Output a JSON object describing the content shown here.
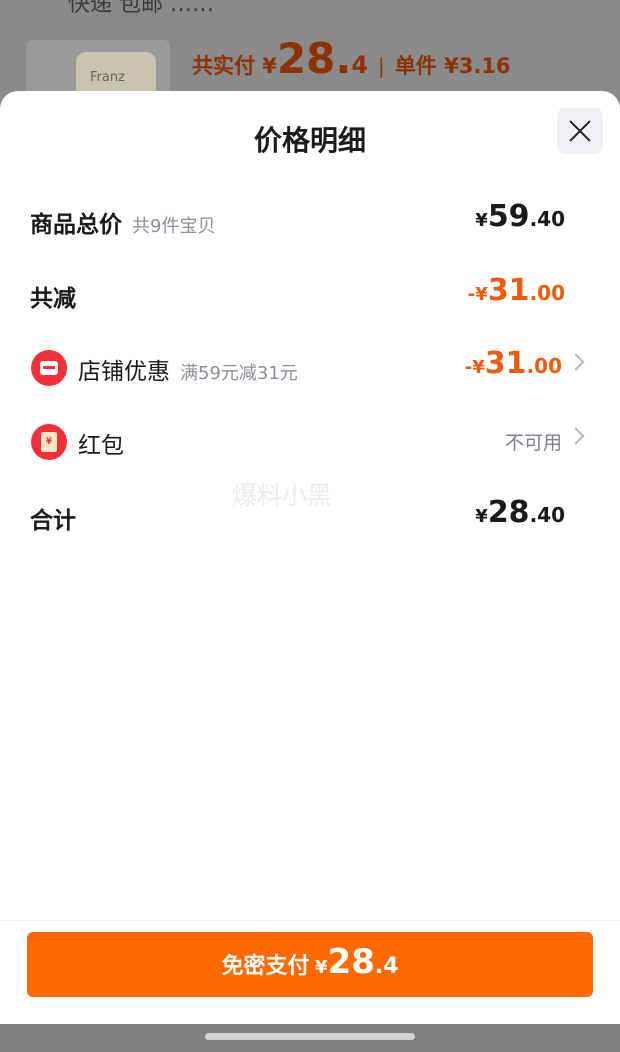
{
  "background": {
    "top_text": "快递 包邮 ……",
    "product_brand": "Franz",
    "total_label": "共实付 ¥",
    "total_int": "28.",
    "total_dec": "4",
    "separator": "|",
    "unit_label": "单件 ¥3.16"
  },
  "sheet": {
    "title": "价格明细",
    "close_icon": "close-icon"
  },
  "rows": {
    "subtotal": {
      "label": "商品总价",
      "sub": "共9件宝贝",
      "currency": "¥",
      "int": "59",
      "dec": ".40"
    },
    "discount_total": {
      "label": "共减",
      "prefix": "-",
      "currency": "¥",
      "int": "31",
      "dec": ".00"
    },
    "store_coupon": {
      "label": "店铺优惠",
      "sub": "满59元减31元",
      "prefix": "-",
      "currency": "¥",
      "int": "31",
      "dec": ".00",
      "icon": "store-icon"
    },
    "red_packet": {
      "label": "红包",
      "status": "不可用",
      "icon": "red-packet-icon",
      "icon_glyph": "¥"
    },
    "total": {
      "label": "合计",
      "currency": "¥",
      "int": "28",
      "dec": ".40"
    }
  },
  "watermark": "爆料小黑",
  "pay_button": {
    "label": "免密支付",
    "currency": "¥",
    "int": "28",
    "dec": ".4"
  },
  "colors": {
    "accent": "#ff6a00",
    "discount": "#f05a0c",
    "icon_red": "#f03038"
  }
}
